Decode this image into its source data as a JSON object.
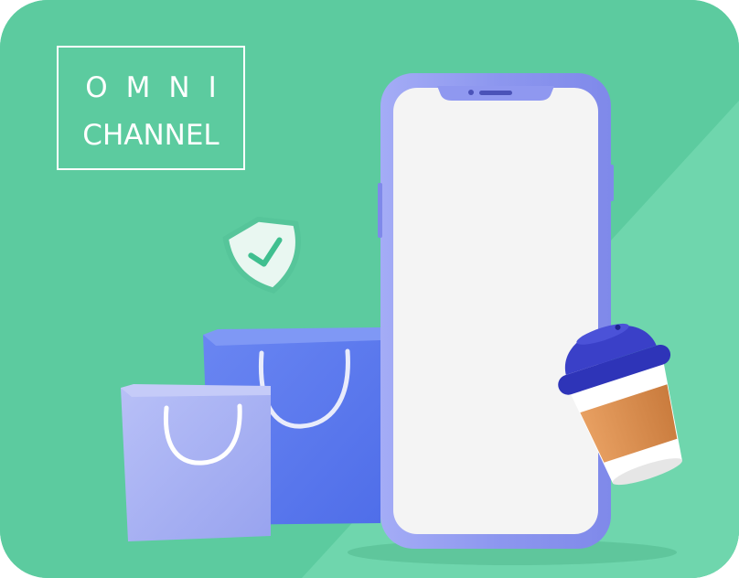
{
  "logo": {
    "line1": "OMNI",
    "line2": "CHANNEL"
  },
  "colors": {
    "background": "#5ccb9f",
    "background_light": "#6fd6ad",
    "phone_frame": "#8f98f0",
    "phone_screen": "#f4f4f4",
    "bag_front": "#a9b3f4",
    "bag_back": "#5f7ff0",
    "cup_lid": "#3a40c8",
    "cup_sleeve": "#d98d4f",
    "shield": "#e9f7f1",
    "check": "#3fbf8f"
  },
  "icons": [
    "shield-check-icon",
    "shopping-bag-icon",
    "smartphone-icon",
    "coffee-cup-icon"
  ]
}
